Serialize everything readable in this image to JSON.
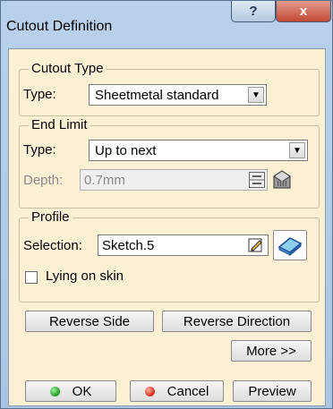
{
  "window": {
    "title": "Cutout Definition",
    "help_label": "?",
    "close_label": "x"
  },
  "cutout_type": {
    "legend": "Cutout Type",
    "type_label": "Type:",
    "type_value": "Sheetmetal standard"
  },
  "end_limit": {
    "legend": "End Limit",
    "type_label": "Type:",
    "type_value": "Up to next",
    "depth_label": "Depth:",
    "depth_value": "0.7mm"
  },
  "profile": {
    "legend": "Profile",
    "selection_label": "Selection:",
    "selection_value": "Sketch.5",
    "lying_on_skin_label": "Lying on skin",
    "lying_on_skin_checked": false
  },
  "buttons": {
    "reverse_side": "Reverse Side",
    "reverse_direction": "Reverse Direction",
    "more": "More >>",
    "ok": "OK",
    "cancel": "Cancel",
    "preview": "Preview"
  },
  "icons": {
    "combo_arrow": "dropdown-arrow-icon",
    "spinner": "spinner-icon",
    "measure": "measure-tool-icon",
    "sketcher": "sketcher-icon",
    "surface": "surface-icon",
    "ok_led": "green-led-icon",
    "cancel_led": "red-led-icon"
  },
  "colors": {
    "panel_background": "#faf1d4",
    "title_gradient": "#b9d1ea",
    "close_button": "#c24a36",
    "ok_led": "#1c9a1c",
    "cancel_led": "#d2281a"
  }
}
